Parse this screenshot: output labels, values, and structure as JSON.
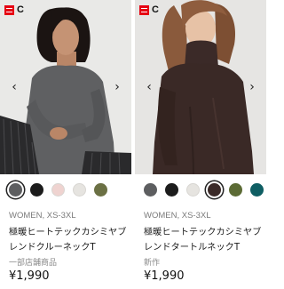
{
  "products": [
    {
      "brand": "C",
      "image_icon": "model-photo-gray-crewneck",
      "prev_icon": "chevron-left-icon",
      "next_icon": "chevron-right-icon",
      "prev_glyph": "‹",
      "next_glyph": "›",
      "colors": [
        {
          "name": "gray",
          "hex": "#5d5e60",
          "selected": true
        },
        {
          "name": "black",
          "hex": "#1c1c1c",
          "selected": false
        },
        {
          "name": "pink",
          "hex": "#efd3d0",
          "selected": false
        },
        {
          "name": "off-white",
          "hex": "#e6e4e0",
          "selected": false
        },
        {
          "name": "olive",
          "hex": "#6b7044",
          "selected": false
        }
      ],
      "meta": "WOMEN, XS-3XL",
      "name": "極暖ヒートテックカシミヤブレンドクルーネックT",
      "note": "一部店舗商品",
      "price": "¥1,990"
    },
    {
      "brand": "C",
      "image_icon": "model-photo-brown-turtleneck",
      "prev_icon": "chevron-left-icon",
      "next_icon": "chevron-right-icon",
      "prev_glyph": "‹",
      "next_glyph": "›",
      "colors": [
        {
          "name": "gray",
          "hex": "#5d5e60",
          "selected": false
        },
        {
          "name": "black",
          "hex": "#1c1c1c",
          "selected": false
        },
        {
          "name": "off-white",
          "hex": "#e6e4e0",
          "selected": false
        },
        {
          "name": "dark-brown",
          "hex": "#3a2a28",
          "selected": true
        },
        {
          "name": "olive",
          "hex": "#5c6b35",
          "selected": false
        },
        {
          "name": "teal",
          "hex": "#0f5e63",
          "selected": false
        }
      ],
      "meta": "WOMEN, XS-3XL",
      "name": "極暖ヒートテックカシミヤブレンドタートルネックT",
      "note": "新作",
      "price": "¥1,990"
    }
  ]
}
